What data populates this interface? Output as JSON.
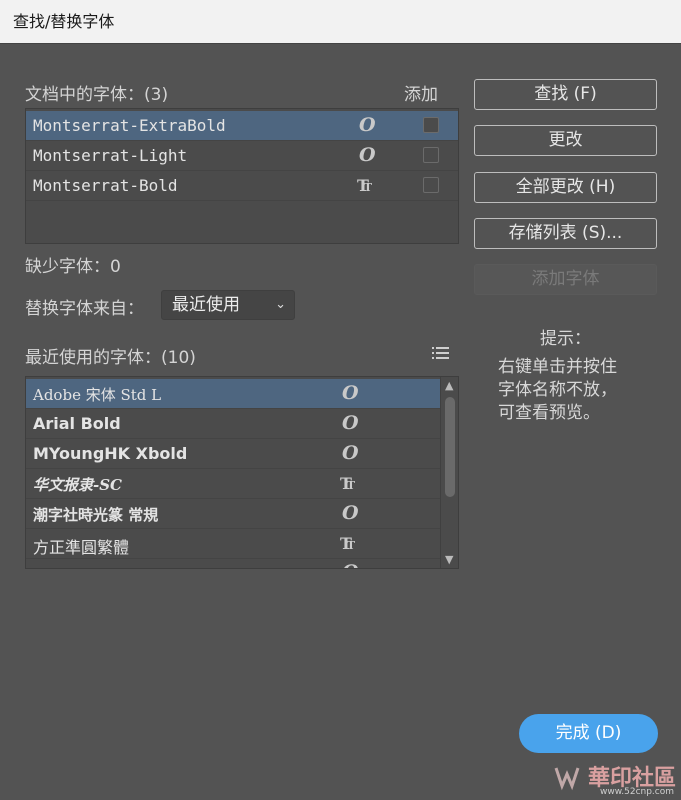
{
  "window": {
    "title": "查找/替换字体"
  },
  "doc_fonts": {
    "label": "文档中的字体：(3)",
    "add_header": "添加",
    "rows": [
      {
        "name": "Montserrat-ExtraBold",
        "icon": "opentype-icon",
        "selected": true
      },
      {
        "name": "Montserrat-Light",
        "icon": "opentype-icon",
        "selected": false
      },
      {
        "name": "Montserrat-Bold",
        "icon": "truetype-icon",
        "selected": false
      }
    ]
  },
  "missing_fonts": {
    "label": "缺少字体：0"
  },
  "replace_from": {
    "label": "替换字体来自：",
    "selected": "最近使用"
  },
  "recent_fonts": {
    "label": "最近使用的字体：(10)",
    "rows": [
      {
        "name": "Adobe 宋体 Std L",
        "icon": "opentype-icon",
        "selected": true
      },
      {
        "name": "Arial Bold",
        "icon": "opentype-icon",
        "selected": false
      },
      {
        "name": "MYoungHK Xbold",
        "icon": "opentype-icon",
        "selected": false
      },
      {
        "name": "华文报隶-SC",
        "icon": "truetype-icon",
        "selected": false
      },
      {
        "name": "潮字社時光篆 常規",
        "icon": "opentype-icon",
        "selected": false
      },
      {
        "name": "方正準圓繁體",
        "icon": "truetype-icon",
        "selected": false
      }
    ]
  },
  "buttons": {
    "find": "查找 (F)",
    "change": "更改",
    "change_all": "全部更改 (H)",
    "save_list": "存储列表 (S)...",
    "add_font": "添加字体",
    "done": "完成 (D)"
  },
  "hint": {
    "title": "提示：",
    "lines": [
      "右键单击并按住",
      "字体名称不放，",
      "可查看预览。"
    ]
  },
  "watermark": {
    "text": "華印社區",
    "sub": "www.52cnp.com"
  }
}
